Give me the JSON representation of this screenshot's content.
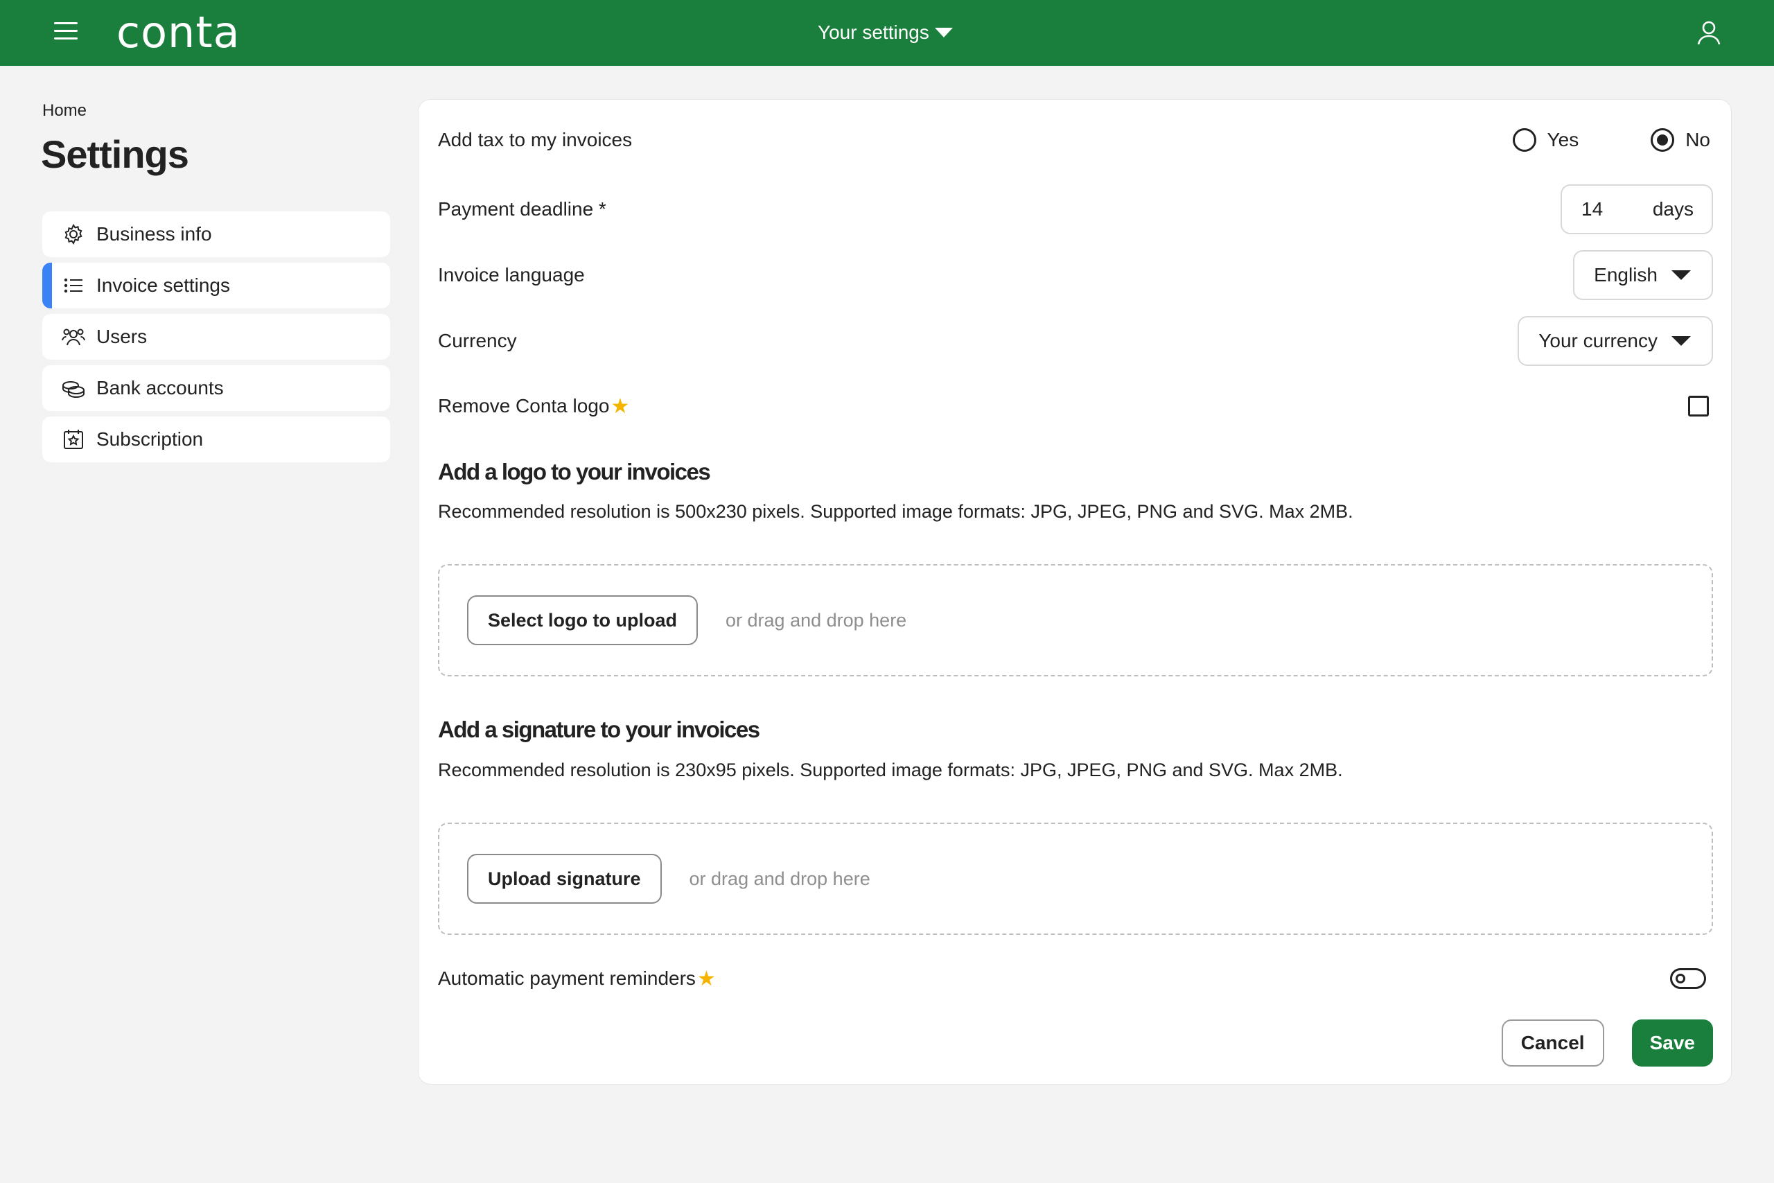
{
  "header": {
    "logo_text": "conta",
    "settings_menu_label": "Your settings"
  },
  "breadcrumb": "Home",
  "page_title": "Settings",
  "sidebar": {
    "items": [
      {
        "label": "Business info",
        "icon": "gear-icon",
        "active": false
      },
      {
        "label": "Invoice settings",
        "icon": "list-icon",
        "active": true
      },
      {
        "label": "Users",
        "icon": "users-icon",
        "active": false
      },
      {
        "label": "Bank accounts",
        "icon": "coins-icon",
        "active": false
      },
      {
        "label": "Subscription",
        "icon": "calendar-star-icon",
        "active": false
      }
    ]
  },
  "form": {
    "tax": {
      "label": "Add tax to my invoices",
      "yes_label": "Yes",
      "no_label": "No",
      "selected": "No"
    },
    "payment_deadline": {
      "label": "Payment deadline *",
      "value": "14",
      "unit": "days"
    },
    "invoice_language": {
      "label": "Invoice language",
      "value": "English"
    },
    "currency": {
      "label": "Currency",
      "value": "Your currency"
    },
    "remove_logo": {
      "label": "Remove Conta logo",
      "checked": false
    },
    "logo_section": {
      "title": "Add a logo to your invoices",
      "description": "Recommended resolution is 500x230 pixels. Supported image formats: JPG, JPEG, PNG and SVG. Max 2MB.",
      "button_label": "Select logo to upload",
      "drop_hint": "or drag and drop here"
    },
    "signature_section": {
      "title": "Add a signature to your invoices",
      "description": "Recommended resolution is 230x95 pixels. Supported image formats: JPG, JPEG, PNG and SVG. Max 2MB.",
      "button_label": "Upload signature",
      "drop_hint": "or drag and drop here"
    },
    "payment_reminders": {
      "label": "Automatic payment reminders",
      "enabled": false
    }
  },
  "actions": {
    "cancel_label": "Cancel",
    "save_label": "Save"
  },
  "colors": {
    "brand_green": "#1a7f3c",
    "active_accent": "#3b82f6",
    "premium_star": "#f5b400"
  }
}
